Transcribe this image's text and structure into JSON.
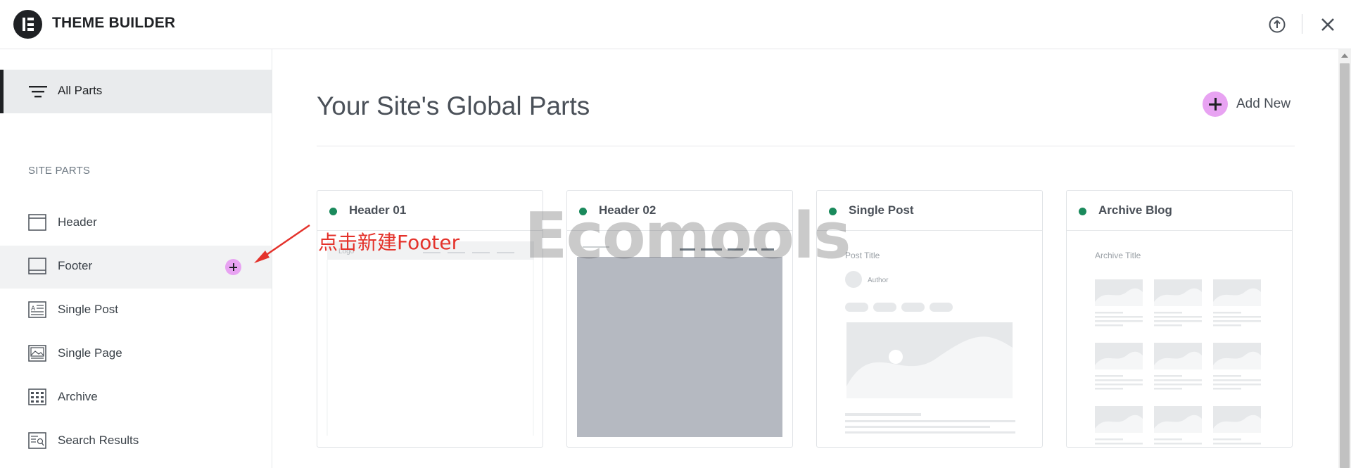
{
  "app": {
    "title": "THEME BUILDER",
    "logo_icon": "elementor-logo-icon"
  },
  "topbar": {
    "help_icon": "upload-circle-icon",
    "close_icon": "close-icon"
  },
  "sidebar": {
    "all_parts_label": "All Parts",
    "section_label": "SITE PARTS",
    "items": [
      {
        "label": "Header",
        "icon": "header-layout-icon"
      },
      {
        "label": "Footer",
        "icon": "footer-layout-icon",
        "active": true
      },
      {
        "label": "Single Post",
        "icon": "single-post-icon"
      },
      {
        "label": "Single Page",
        "icon": "single-page-icon"
      },
      {
        "label": "Archive",
        "icon": "archive-grid-icon"
      },
      {
        "label": "Search Results",
        "icon": "search-results-icon"
      }
    ]
  },
  "main": {
    "title": "Your Site's Global Parts",
    "add_new_label": "Add New",
    "cards": [
      {
        "name": "Header 01",
        "status_color": "#1a8a5c",
        "preview_text": "Logo"
      },
      {
        "name": "Header 02",
        "status_color": "#1a8a5c"
      },
      {
        "name": "Single Post",
        "status_color": "#1a8a5c",
        "preview_title": "Post Title",
        "preview_author": "Author"
      },
      {
        "name": "Archive Blog",
        "status_color": "#1a8a5c",
        "preview_title": "Archive Title"
      }
    ]
  },
  "annotation": {
    "text": "点击新建Footer",
    "color": "#e4322b"
  },
  "watermark": {
    "text": "Ecomools"
  },
  "colors": {
    "accent": "#e8a3f2",
    "status_green": "#1a8a5c",
    "text_dark": "#1f2124"
  }
}
